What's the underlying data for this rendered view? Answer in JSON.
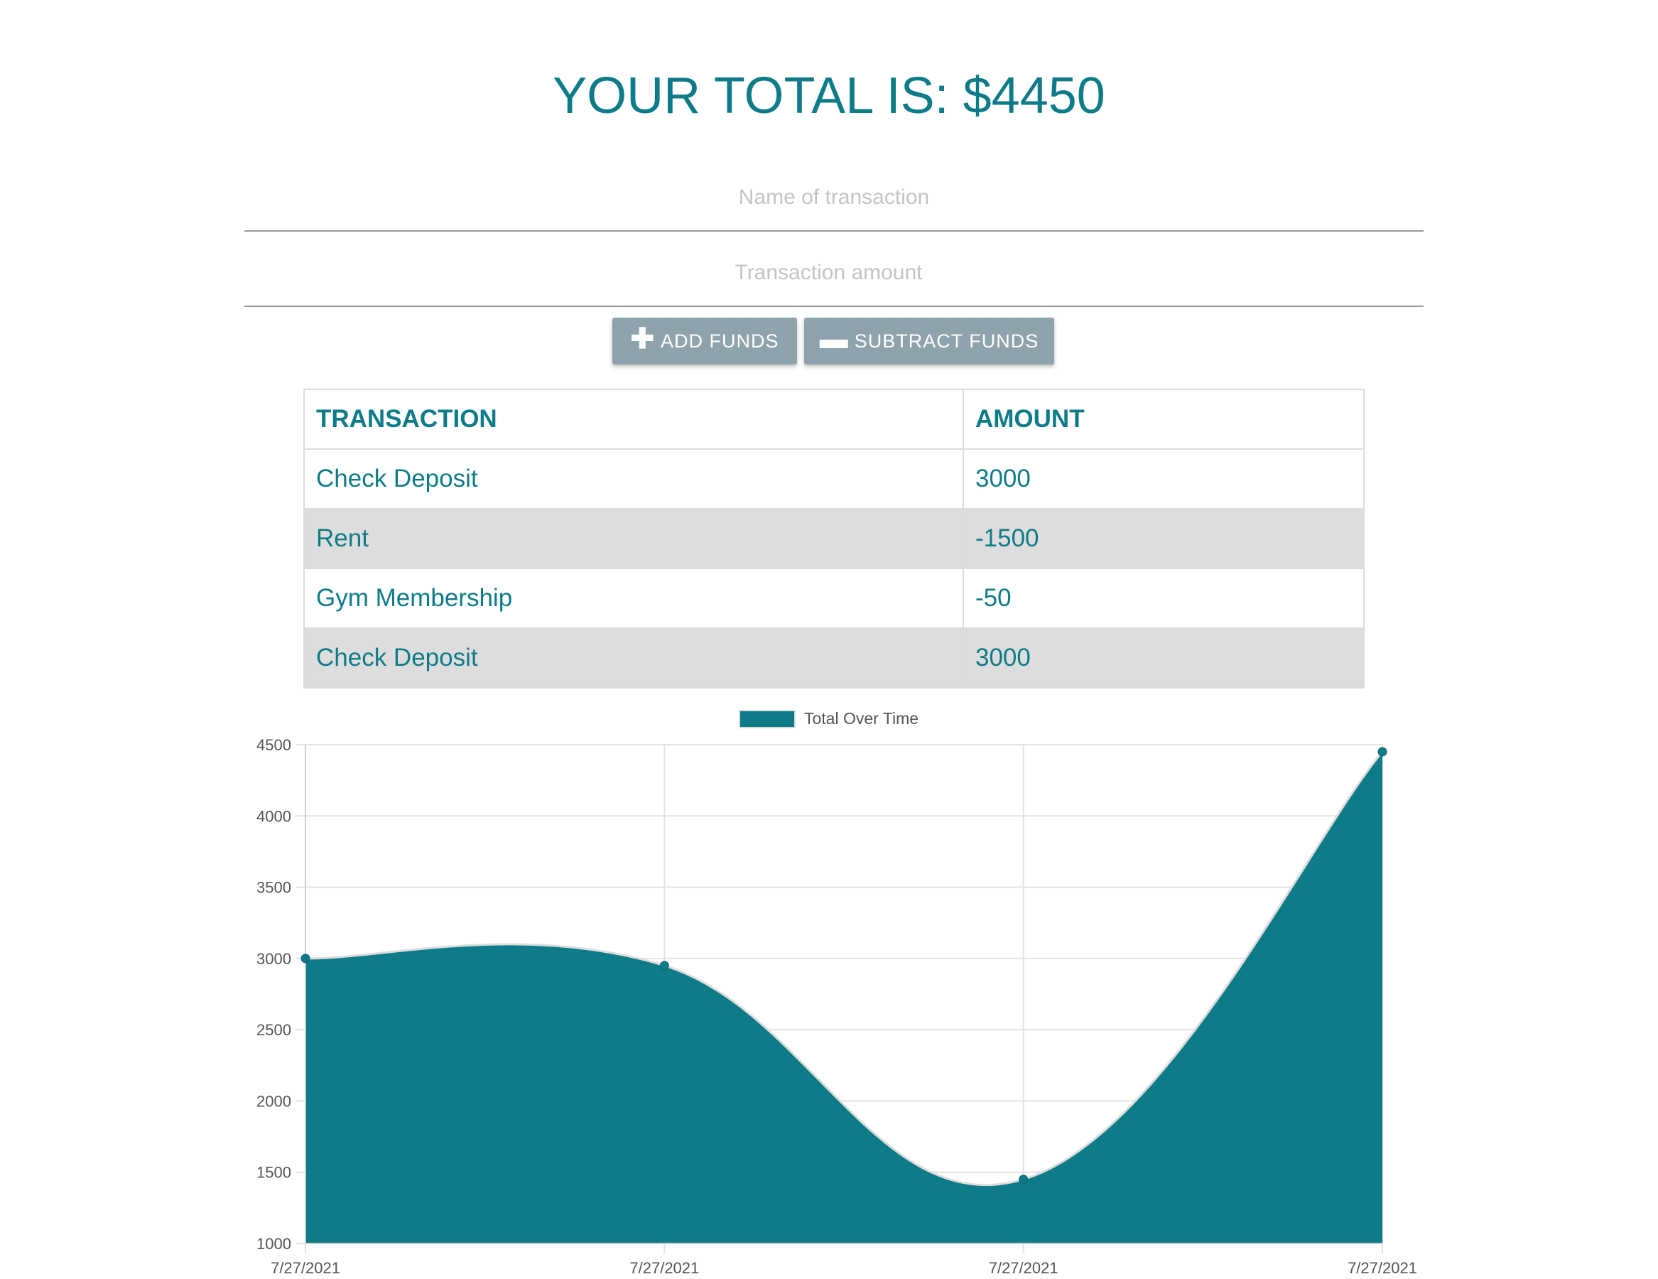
{
  "header": {
    "total_text": "YOUR TOTAL IS: $4450"
  },
  "form": {
    "name_placeholder": "Name of transaction",
    "amount_placeholder": "Transaction amount",
    "add_label": "ADD FUNDS",
    "add_icon": "plus-icon",
    "subtract_label": "SUBTRACT FUNDS",
    "subtract_icon": "minus-icon"
  },
  "table": {
    "headers": [
      "TRANSACTION",
      "AMOUNT"
    ],
    "rows": [
      {
        "name": "Check Deposit",
        "amount": "3000"
      },
      {
        "name": "Rent",
        "amount": "-1500"
      },
      {
        "name": "Gym Membership",
        "amount": "-50"
      },
      {
        "name": "Check Deposit",
        "amount": "3000"
      }
    ]
  },
  "colors": {
    "accent": "#0e7c88",
    "button": "#8fa3ad",
    "stripe": "#dddddd"
  },
  "chart_data": {
    "type": "area",
    "x": [
      "7/27/2021",
      "7/27/2021",
      "7/27/2021",
      "7/27/2021"
    ],
    "series": [
      {
        "name": "Total Over Time",
        "values": [
          3000,
          2950,
          1450,
          4450
        ]
      }
    ],
    "ylim": [
      1000,
      4500
    ],
    "yticks": [
      1000,
      1500,
      2000,
      2500,
      3000,
      3500,
      4000,
      4500
    ],
    "grid": true,
    "legend": "top-center",
    "smooth": true
  }
}
